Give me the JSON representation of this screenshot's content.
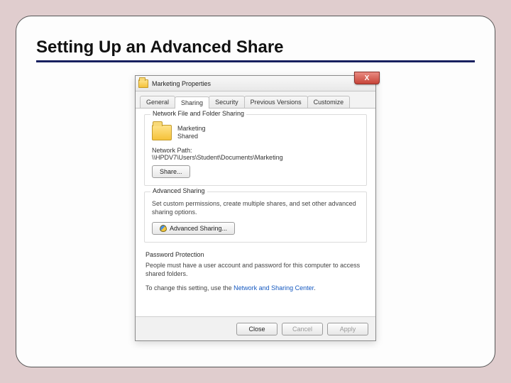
{
  "slide": {
    "title": "Setting Up an Advanced Share"
  },
  "dialog": {
    "title": "Marketing Properties",
    "close_glyph": "X",
    "tabs": [
      "General",
      "Sharing",
      "Security",
      "Previous Versions",
      "Customize"
    ],
    "active_tab": 1,
    "nfs": {
      "group_title": "Network File and Folder Sharing",
      "folder_name": "Marketing",
      "folder_state": "Shared",
      "net_path_label": "Network Path:",
      "net_path_value": "\\\\HPDV7\\Users\\Student\\Documents\\Marketing",
      "share_btn": "Share..."
    },
    "adv": {
      "group_title": "Advanced Sharing",
      "desc": "Set custom permissions, create multiple shares, and set other advanced sharing options.",
      "btn": "Advanced Sharing..."
    },
    "pw": {
      "group_title": "Password Protection",
      "desc1": "People must have a user account and password for this computer to access shared folders.",
      "desc2_pre": "To change this setting, use the ",
      "desc2_link": "Network and Sharing Center",
      "desc2_post": "."
    },
    "footer": {
      "close": "Close",
      "cancel": "Cancel",
      "apply": "Apply"
    }
  }
}
